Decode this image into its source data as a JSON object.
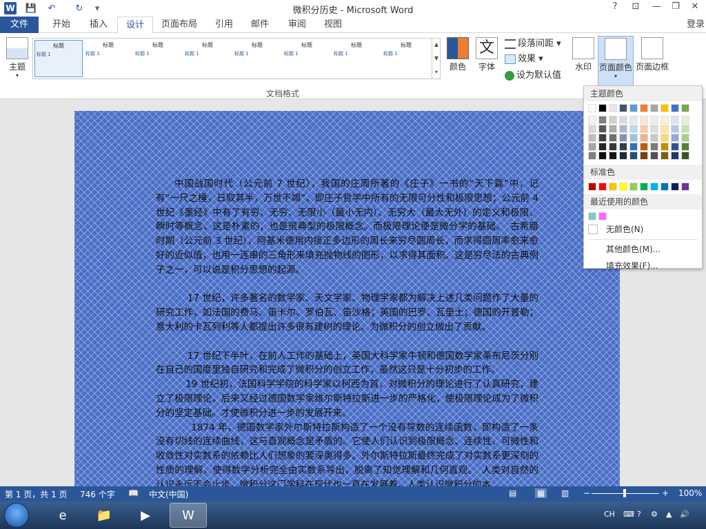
{
  "app": {
    "title": "微积分历史 - Microsoft Word",
    "login": "登录"
  },
  "window_controls": {
    "help": "?",
    "restore_ribbon": "⊡",
    "minimize": "—",
    "maximize": "❐",
    "close": "✕"
  },
  "quick_access": {
    "save": "💾",
    "undo": "↶",
    "redo": "↻",
    "customize": "▾"
  },
  "tabs": [
    {
      "label": "文件"
    },
    {
      "label": "开始"
    },
    {
      "label": "插入"
    },
    {
      "label": "设计"
    },
    {
      "label": "页面布局"
    },
    {
      "label": "引用"
    },
    {
      "label": "邮件"
    },
    {
      "label": "审阅"
    },
    {
      "label": "视图"
    }
  ],
  "ribbon": {
    "theme_label": "主题",
    "gallery": [
      {
        "title": "标题",
        "heading": "标题 1"
      },
      {
        "title": "标题",
        "heading": "标题 1"
      },
      {
        "title": "标题",
        "heading": "标题 1"
      },
      {
        "title": "标题",
        "heading": "标题 1"
      },
      {
        "title": "标题",
        "heading": "标题 1"
      },
      {
        "title": "标题",
        "heading": "标题 1"
      },
      {
        "title": "标题",
        "heading": "标题 1"
      },
      {
        "title": "标题",
        "heading": "标题 1"
      },
      {
        "title": "标题",
        "heading": "标题 1"
      }
    ],
    "group_doc_format": "文档格式",
    "colors_label": "颜色",
    "fonts_label": "字体",
    "font_glyph": "文",
    "para_spacing": "段落间距",
    "effects": "效果",
    "set_default": "设为默认值",
    "watermark": "水印",
    "page_color": "页面颜色",
    "page_border": "页面边框"
  },
  "dropdown": {
    "theme_colors_header": "主题颜色",
    "theme_colors": [
      "#ffffff",
      "#000000",
      "#e7e6e6",
      "#44546a",
      "#5b9bd5",
      "#ed7d31",
      "#a5a5a5",
      "#ffc000",
      "#4472c4",
      "#70ad47"
    ],
    "shades": [
      [
        "#f2f2f2",
        "#7f7f7f",
        "#d0cece",
        "#d6dce4",
        "#deebf6",
        "#fbe5d5",
        "#ededed",
        "#fff2cc",
        "#dae3f3",
        "#e2efd9"
      ],
      [
        "#d8d8d8",
        "#595959",
        "#aeabab",
        "#adb9ca",
        "#bdd7ee",
        "#f7cbac",
        "#dbdbdb",
        "#fee599",
        "#b4c6e7",
        "#c5e0b3"
      ],
      [
        "#bfbfbf",
        "#3f3f3f",
        "#757070",
        "#8496b0",
        "#9cc3e5",
        "#f4b183",
        "#c9c9c9",
        "#ffd965",
        "#8eaadb",
        "#a8d08d"
      ],
      [
        "#a5a5a5",
        "#262626",
        "#3a3838",
        "#323f4f",
        "#2e75b5",
        "#c55a11",
        "#7b7b7b",
        "#bf9000",
        "#2f5496",
        "#538135"
      ],
      [
        "#7f7f7f",
        "#0c0c0c",
        "#171616",
        "#222a35",
        "#1e4e79",
        "#833c0b",
        "#525252",
        "#7f6000",
        "#1f3864",
        "#375623"
      ]
    ],
    "standard_header": "标准色",
    "standard_colors": [
      "#c00000",
      "#ff0000",
      "#ffc000",
      "#ffff00",
      "#92d050",
      "#00b050",
      "#00b0f0",
      "#0070c0",
      "#002060",
      "#7030a0"
    ],
    "recent_header": "最近使用的颜色",
    "recent_colors": [
      "#7fcfc8",
      "#ff66ff"
    ],
    "no_color": "无颜色(N)",
    "more_colors": "其他颜色(M)...",
    "fill_effects": "填充效果(F)..."
  },
  "document": {
    "paragraphs": [
      "中国战国时代（公元前 7 世纪），我国的庄周所著的《庄子》一书的“天下篇”中，记有“一尺之棰，日取其半，万世不竭”，即庄子哲学中所有的无限可分性和极限思想；公元前 4 世纪《墨经》中有了有穷、无穷、无限小（最小无内）、无穷大（最大无外）的定义和极限、瞬时等概念，这是朴素的，也是很典型的极限概念。而极限理论便是微分学的基础。　古希腊时期（公元前 3 世纪），阿基米德用内接正多边形的周长来穷尽圆周长，而求得圆周率愈来愈好的近似值，也用一连串的三角形来填充抛物线的图形，以求得其面积。这是穷尽法的古典例子之一，可以说是积分思想的起源。",
      "17 世纪，许多著名的数学家、天文学家、物理学家都为解决上述几类问题作了大量的研究工作，如法国的费马、笛卡尔、罗伯瓦、笛沙格；英国的巴罗、瓦里士；德国的开普勒；意大利的卡瓦列利等人都提出许多很有建树的理论。为微积分的创立做出了贡献。",
      "17 世纪下半叶，在前人工作的基础上，英国大科学家牛顿和德国数学家莱布尼茨分别在自己的国度里独自研究和完成了微积分的创立工作，虽然这只是十分初步的工作。",
      "19 世纪初，法国科学学院的科学家以柯西为首，对微积分的理论进行了认真研究，建立了极限理论，后来又经过德国数学家维尔斯特拉斯进一步的严格化，使极限理论成为了微积分的坚定基础。才使微积分进一步的发展开来。",
      "1874 年，德国数学家外尔斯特拉斯构造了一个没有导数的连续函数，即构造了一条没有切线的连续曲线，这与直观概念是矛盾的。它使人们认识到极限概念、连续性、可微性和收敛性对实数系的依赖比人们想象的要深奥得多。外尔斯特拉斯最终完成了对实数系更深刻的性质的理解，使得数学分析完全由实数系导出，脱离了知觉理解和几何直观。　人类对自然的认识永远不会止步，微积分这门学科在现代也一直在发展着。人类认识微积分的本"
    ]
  },
  "statusbar": {
    "page": "第 1 页，共 1 页",
    "words": "746 个字",
    "lang": "中文(中国)",
    "zoom": "100%"
  },
  "tray": {
    "lang": "CH",
    "time": ""
  }
}
